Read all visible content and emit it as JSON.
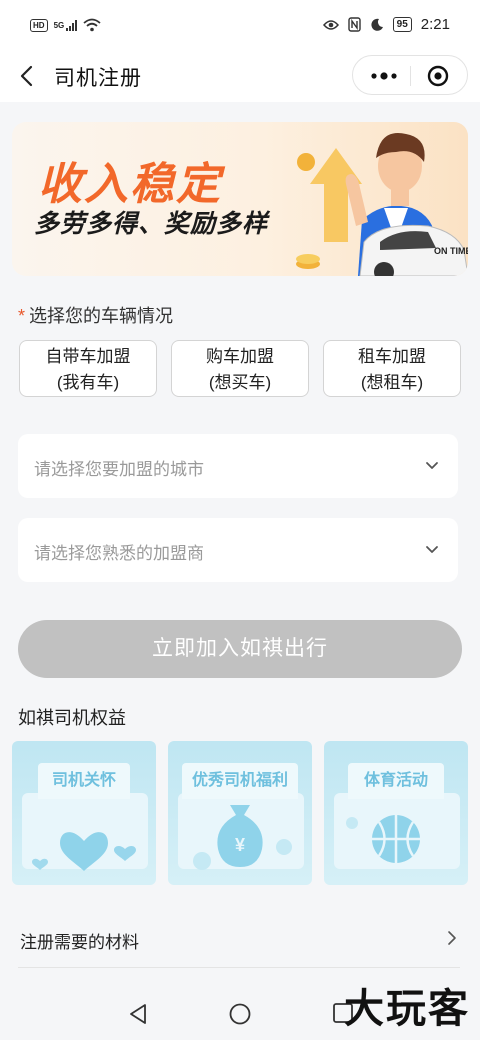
{
  "status_bar": {
    "hd_badge": "HD",
    "network": "5G",
    "time": "2:21",
    "battery": "95",
    "icons": [
      "signal-icon",
      "wifi-icon",
      "eye-icon",
      "nfc-icon",
      "moon-icon",
      "battery-icon"
    ]
  },
  "nav": {
    "title": "司机注册",
    "icons": [
      "back-arrow-icon",
      "more-icon",
      "close-circle-icon"
    ]
  },
  "banner": {
    "headline": "收入稳定",
    "subline": "多劳多得、奖励多样",
    "badge": "ON TIME"
  },
  "vehicle": {
    "required_mark": "*",
    "label": "选择您的车辆情况",
    "options": [
      {
        "line1": "自带车加盟",
        "line2": "(我有车)"
      },
      {
        "line1": "购车加盟",
        "line2": "(想买车)"
      },
      {
        "line1": "租车加盟",
        "line2": "(想租车)"
      }
    ]
  },
  "selects": {
    "city_placeholder": "请选择您要加盟的城市",
    "partner_placeholder": "请选择您熟悉的加盟商"
  },
  "join_button": "立即加入如祺出行",
  "benefits": {
    "title": "如祺司机权益",
    "cards": [
      {
        "label": "司机关怀",
        "icon": "heart-icon"
      },
      {
        "label": "优秀司机福利",
        "icon": "money-bag-icon"
      },
      {
        "label": "体育活动",
        "icon": "basketball-icon"
      }
    ]
  },
  "materials": {
    "label": "注册需要的材料"
  },
  "watermark": "大玩客",
  "colors": {
    "accent_orange": "#f2682a",
    "button_disabled": "#c1c1c1",
    "card_blue": "#bfe6f2"
  }
}
